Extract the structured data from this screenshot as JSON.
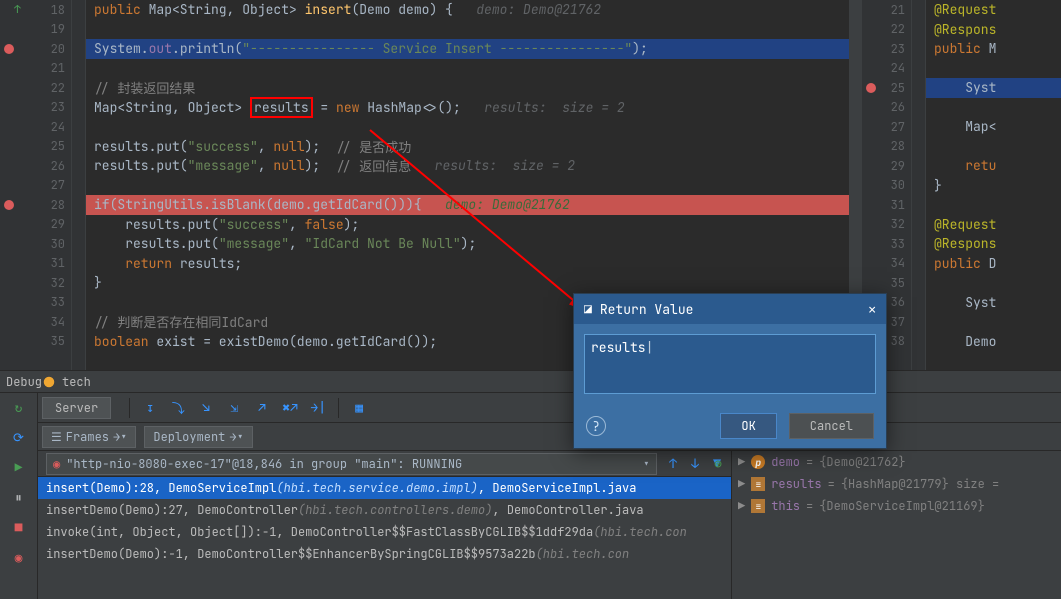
{
  "left": {
    "lines_start": 18,
    "lines": [
      18,
      19,
      20,
      21,
      22,
      23,
      24,
      25,
      26,
      27,
      28,
      29,
      30,
      31,
      32,
      33,
      34,
      35
    ],
    "code": {
      "l18_pre": "public ",
      "l18_map": "Map<String, Object> ",
      "l18_method": "insert",
      "l18_args": "(Demo demo) {   ",
      "l18_hint": "demo: Demo@21762",
      "l20": "System.",
      "l20_out": "out",
      "l20_rest": ".println(",
      "l20_str": "\"---------------- Service Insert ----------------\"",
      "l20_end": ");",
      "l22_comment": "// 封装返回结果",
      "l23_type": "Map<String, Object> ",
      "l23_var": "results",
      "l23_mid": " = ",
      "l23_new": "new ",
      "l23_hash": "HashMap<>();   ",
      "l23_hint": "results:  size = 2",
      "l25_a": "results.put(",
      "l25_s": "\"success\"",
      "l25_b": ", ",
      "l25_null": "null",
      "l25_c": ");  ",
      "l25_comment": "// 是否成功",
      "l26_a": "results.put(",
      "l26_s": "\"message\"",
      "l26_b": ", ",
      "l26_null": "null",
      "l26_c": ");  ",
      "l26_comment": "// 返回信息   ",
      "l26_hint": "results:  size = 2",
      "l28_a": "if(StringUtils.isBlank(demo.getIdCard())){   ",
      "l28_hint": "demo: Demo@21762",
      "l29_a": "    results.put(",
      "l29_s": "\"success\"",
      "l29_b": ", ",
      "l29_false": "false",
      "l29_c": ");",
      "l30_a": "    results.put(",
      "l30_s": "\"message\"",
      "l30_b": ", ",
      "l30_str": "\"IdCard Not Be Null\"",
      "l30_c": ");",
      "l31_a": "    ",
      "l31_ret": "return ",
      "l31_b": "results;",
      "l32": "}",
      "l34_comment": "// 判断是否存在相同IdCard",
      "l35_a": "boolean ",
      "l35_b": "exist = existDemo(demo.getIdCard());"
    }
  },
  "right": {
    "lines": [
      21,
      22,
      23,
      24,
      25,
      26,
      27,
      28,
      29,
      30,
      31,
      32,
      33,
      34,
      35,
      36,
      37,
      38
    ],
    "code": {
      "l21": "@Request",
      "l22": "@Respons",
      "l23_a": "public",
      "l23_b": " M",
      "l25": "    Syst",
      "l27": "    Map<",
      "l29_a": "    ",
      "l29_ret": "retu",
      "l30": "}",
      "l32": "@Request",
      "l33": "@Respons",
      "l34_a": "public",
      "l34_b": " D",
      "l36": "    Syst",
      "l38": "    Demo"
    }
  },
  "debug": {
    "bar_label": "Debug",
    "bar_config": "tech",
    "server_tab": "Server",
    "frames_tab": "Frames",
    "deployment_tab": "Deployment",
    "thread": "\"http-nio-8080-exec-17\"@18,846 in group \"main\": RUNNING",
    "frames": [
      {
        "text": "insert(Demo):28, DemoServiceImpl ",
        "pkg": "(hbi.tech.service.demo.impl)",
        "tail": ", DemoServiceImpl.java"
      },
      {
        "text": "insertDemo(Demo):27, DemoController ",
        "pkg": "(hbi.tech.controllers.demo)",
        "tail": ", DemoController.java"
      },
      {
        "text": "invoke(int, Object, Object[]):-1, DemoController$$FastClassByCGLIB$$1ddf29da ",
        "pkg": "(hbi.tech.con",
        "tail": ""
      },
      {
        "text": "insertDemo(Demo):-1, DemoController$$EnhancerBySpringCGLIB$$9573a22b ",
        "pkg": "(hbi.tech.con",
        "tail": ""
      }
    ],
    "vars": [
      {
        "name": "demo",
        "val": "{Demo@21762}",
        "type": "p"
      },
      {
        "name": "results",
        "val": "{HashMap@21779}  size =",
        "type": "f"
      },
      {
        "name": "this",
        "val": "{DemoServiceImpl@21169}",
        "type": "f"
      }
    ]
  },
  "modal": {
    "title": "Return Value",
    "value": "results",
    "cursor": "|",
    "ok": "OK",
    "cancel": "Cancel"
  }
}
